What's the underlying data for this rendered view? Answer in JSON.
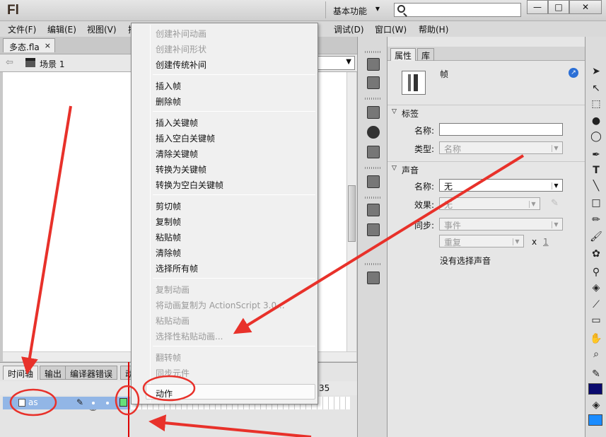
{
  "app": {
    "logo": "Fl",
    "workspace": "基本功能",
    "window_buttons": [
      "—",
      "□",
      "✕"
    ]
  },
  "menubar": [
    "文件(F)",
    "编辑(E)",
    "视图(V)",
    "插",
    "调试(D)",
    "窗口(W)",
    "帮助(H)"
  ],
  "document": {
    "tab": "多态.fla",
    "tab_close": "×",
    "scene": "场景 1"
  },
  "timeline": {
    "tabs": [
      "时间轴",
      "输出",
      "编译器错误",
      "动"
    ],
    "frame_number": "35",
    "layer_name": "as"
  },
  "context_menu": {
    "groups": [
      [
        {
          "label": "创建补间动画",
          "enabled": false
        },
        {
          "label": "创建补间形状",
          "enabled": false
        },
        {
          "label": "创建传统补间",
          "enabled": true
        }
      ],
      [
        {
          "label": "插入帧",
          "enabled": true
        },
        {
          "label": "删除帧",
          "enabled": true
        }
      ],
      [
        {
          "label": "插入关键帧",
          "enabled": true
        },
        {
          "label": "插入空白关键帧",
          "enabled": true
        },
        {
          "label": "清除关键帧",
          "enabled": true
        },
        {
          "label": "转换为关键帧",
          "enabled": true
        },
        {
          "label": "转换为空白关键帧",
          "enabled": true
        }
      ],
      [
        {
          "label": "剪切帧",
          "enabled": true
        },
        {
          "label": "复制帧",
          "enabled": true
        },
        {
          "label": "粘贴帧",
          "enabled": true
        },
        {
          "label": "清除帧",
          "enabled": true
        },
        {
          "label": "选择所有帧",
          "enabled": true
        }
      ],
      [
        {
          "label": "复制动画",
          "enabled": false
        },
        {
          "label": "将动画复制为 ActionScript 3.0...",
          "enabled": false
        },
        {
          "label": "粘贴动画",
          "enabled": false
        },
        {
          "label": "选择性粘贴动画...",
          "enabled": false
        }
      ],
      [
        {
          "label": "翻转帧",
          "enabled": false
        },
        {
          "label": "同步元件",
          "enabled": false
        }
      ],
      [
        {
          "label": "动作",
          "enabled": true,
          "highlighted": true
        }
      ]
    ]
  },
  "properties": {
    "tabs": [
      "属性",
      "库"
    ],
    "title": "帧",
    "label_section": "标签",
    "name_label": "名称:",
    "name_value": "",
    "type_label": "类型:",
    "type_value": "名称",
    "sound_section": "声音",
    "sound_name_label": "名称:",
    "sound_name_value": "无",
    "effect_label": "效果:",
    "effect_value": "无",
    "sync_label": "同步:",
    "sync_value": "事件",
    "repeat_value": "重复",
    "repeat_x": "x",
    "repeat_count": "1",
    "no_sound": "没有选择声音"
  },
  "colors": {
    "annotation": "#e8312a",
    "layer_highlight": "#92b6e6",
    "stroke_swatch": "#0a0a6e",
    "fill_swatch": "#1a8cff"
  }
}
